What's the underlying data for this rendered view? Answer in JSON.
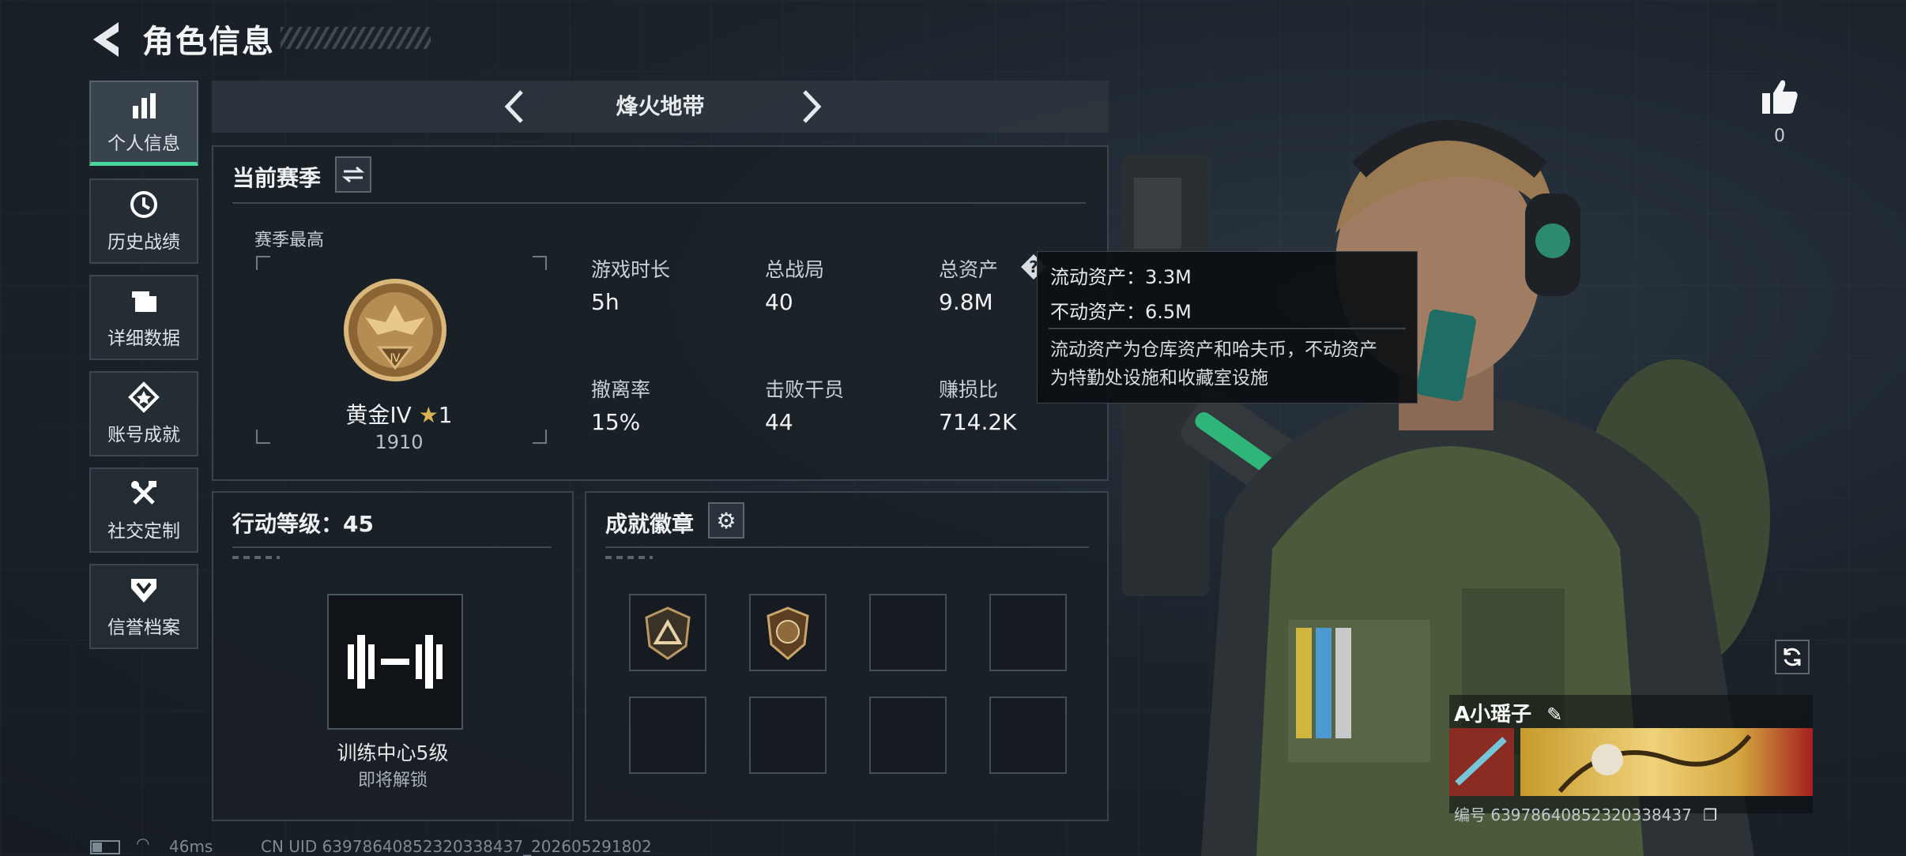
{
  "header": {
    "title": "角色信息"
  },
  "sidebar": {
    "items": [
      {
        "label": "个人信息",
        "icon": "bar-chart-icon",
        "active": true
      },
      {
        "label": "历史战绩",
        "icon": "history-clock-icon"
      },
      {
        "label": "详细数据",
        "icon": "folder-icon"
      },
      {
        "label": "账号成就",
        "icon": "achievement-star-icon"
      },
      {
        "label": "社交定制",
        "icon": "tools-icon"
      },
      {
        "label": "信誉档案",
        "icon": "shield-chevron-icon"
      }
    ]
  },
  "mode_bar": {
    "name": "烽火地带"
  },
  "season": {
    "title": "当前赛季",
    "best_label": "赛季最高",
    "rank_name": "黄金IV",
    "rank_stars": "1",
    "rank_points": "1910",
    "rank_numeral": "Ⅳ",
    "stats": [
      {
        "label": "游戏时长",
        "value": "5h"
      },
      {
        "label": "总战局",
        "value": "40"
      },
      {
        "label": "总资产",
        "value": "9.8M"
      },
      {
        "label": "撤离率",
        "value": "15%"
      },
      {
        "label": "击败干员",
        "value": "44"
      },
      {
        "label": "赚损比",
        "value": "714.2K"
      }
    ]
  },
  "tooltip": {
    "liquid": "流动资产：3.3M",
    "fixed": "不动资产：6.5M",
    "description_line1": "流动资产为仓库资产和哈夫币，不动资产",
    "description_line2": "为特勤处设施和收藏室设施"
  },
  "action_level": {
    "title": "行动等级：45",
    "unlock_name": "训练中心5级",
    "unlock_status": "即将解锁"
  },
  "badges": {
    "title": "成就徽章"
  },
  "social": {
    "like_count": "0"
  },
  "player": {
    "name": "A小瑶子",
    "id": "编号 6397864085232033843​7"
  },
  "footer": {
    "ping": "46ms",
    "uid": "CN UID 6397864085232033843​7_202605291802"
  },
  "colors": {
    "accent_green": "#47d59a",
    "gold": "#c8a25a"
  }
}
